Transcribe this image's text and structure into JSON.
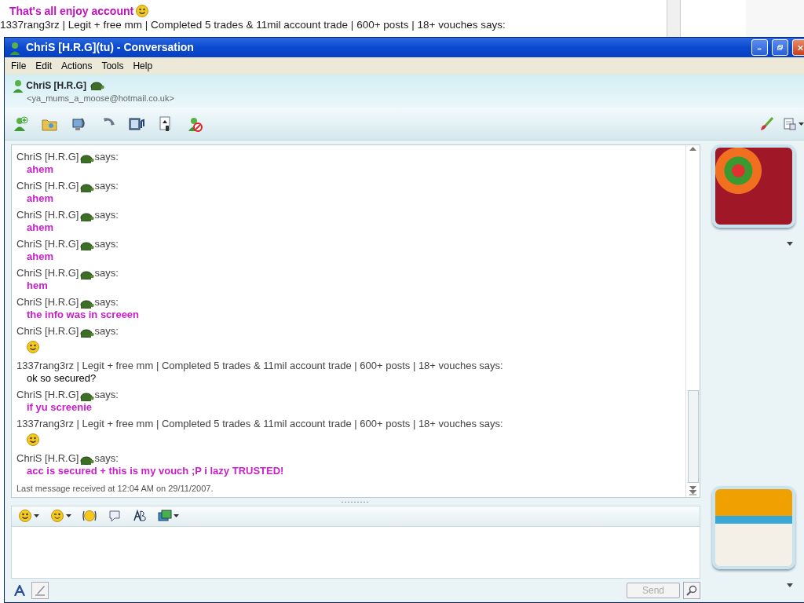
{
  "background_page": {
    "post_text": "That's all enjoy account",
    "post_smiley": true,
    "next_sender": "1337rang3rz | Legit + free mm | Completed 5 trades & 11mil account trade | 600+ posts | 18+ vouches says:"
  },
  "window": {
    "title": "ChriS [H.R.G](tu) - Conversation"
  },
  "menu": [
    "File",
    "Edit",
    "Actions",
    "Tools",
    "Help"
  ],
  "contact": {
    "name": "ChriS [H.R.G]",
    "email": "<ya_mums_a_moose@hotmail.co.uk>"
  },
  "messages": [
    {
      "sender": "ChriS [H.R.G]",
      "turtle": true,
      "says": "says:",
      "kind": "bold",
      "text": "ahem"
    },
    {
      "sender": "ChriS [H.R.G]",
      "turtle": true,
      "says": "says:",
      "kind": "bold",
      "text": "ahem"
    },
    {
      "sender": "ChriS [H.R.G]",
      "turtle": true,
      "says": "says:",
      "kind": "bold",
      "text": "ahem"
    },
    {
      "sender": "ChriS [H.R.G]",
      "turtle": true,
      "says": "says:",
      "kind": "bold",
      "text": "ahem"
    },
    {
      "sender": "ChriS [H.R.G]",
      "turtle": true,
      "says": "says:",
      "kind": "bold",
      "text": "hem"
    },
    {
      "sender": "ChriS [H.R.G]",
      "turtle": true,
      "says": "says:",
      "kind": "bold",
      "text": "the info was in screeen"
    },
    {
      "sender": "ChriS [H.R.G]",
      "turtle": true,
      "says": "says:",
      "kind": "smiley"
    },
    {
      "sender": "1337rang3rz | Legit + free mm | Completed 5 trades & 11mil account trade | 600+ posts | 18+ vouches",
      "turtle": false,
      "says": "says:",
      "kind": "plain",
      "text": "ok so secured?"
    },
    {
      "sender": "ChriS [H.R.G]",
      "turtle": true,
      "says": "says:",
      "kind": "bold",
      "text": "if yu screenie"
    },
    {
      "sender": "1337rang3rz | Legit + free mm | Completed 5 trades & 11mil account trade | 600+ posts | 18+ vouches",
      "turtle": false,
      "says": "says:",
      "kind": "smiley"
    },
    {
      "sender": "ChriS [H.R.G]",
      "turtle": true,
      "says": "says:",
      "kind": "bold",
      "text": "acc is secured + this is my vouch ;P i lazy TRUSTED!"
    }
  ],
  "status_line": "Last message received at 12:04 AM on 29/11/2007.",
  "send_button": {
    "label": "Send",
    "disabled": true
  }
}
